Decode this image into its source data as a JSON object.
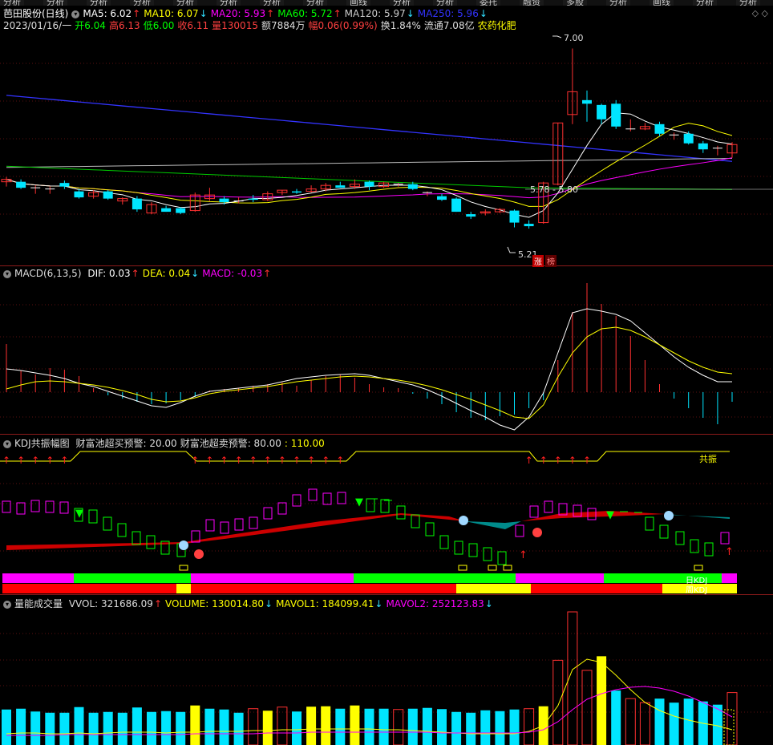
{
  "top_menu": [
    "分析",
    "分析",
    "分析",
    "分析",
    "分析",
    "分析",
    "分析",
    "分析",
    "画线",
    "分析",
    "分析",
    "委托",
    "融资",
    "多股",
    "分析",
    "画线",
    "分析",
    "分析"
  ],
  "window_controls": "◇ ◇",
  "price_panel": {
    "title": "芭田股份(日线)",
    "ma": [
      {
        "label": "MA5: 6.02",
        "arrow": "↑",
        "color": "#ffffff"
      },
      {
        "label": "MA10: 6.07",
        "arrow": "↓",
        "color": "#ffff00"
      },
      {
        "label": "MA20: 5.93",
        "arrow": "↑",
        "color": "#ff00ff"
      },
      {
        "label": "MA60: 5.72",
        "arrow": "↑",
        "color": "#00ff00"
      },
      {
        "label": "MA120: 5.97",
        "arrow": "↓",
        "color": "#cccccc"
      },
      {
        "label": "MA250: 5.96",
        "arrow": "↓",
        "color": "#3333ff"
      }
    ],
    "info": [
      {
        "text": "2023/01/16/一",
        "color": "#dddddd"
      },
      {
        "text": "开6.04",
        "color": "#00ff00"
      },
      {
        "text": "高6.13",
        "color": "#ff4040"
      },
      {
        "text": "低6.00",
        "color": "#00ff00"
      },
      {
        "text": "收6.11",
        "color": "#ff4040"
      },
      {
        "text": "量130015",
        "color": "#ff4040"
      },
      {
        "text": "额7884万",
        "color": "#dddddd"
      },
      {
        "text": "幅0.06(0.99%)",
        "color": "#ff4040"
      },
      {
        "text": "换1.84%",
        "color": "#dddddd"
      },
      {
        "text": "流通7.08亿",
        "color": "#dddddd"
      },
      {
        "text": "农药化肥",
        "color": "#ffff00"
      }
    ],
    "annotations": {
      "high": "7.00",
      "low": "5.21",
      "range": "5.78 - 5.80",
      "zt": "涨",
      "bang": "榜"
    }
  },
  "macd_panel": {
    "title": "MACD(6,13,5)",
    "items": [
      {
        "label": "DIF: 0.03",
        "arrow": "↑",
        "color": "#ffffff"
      },
      {
        "label": "DEA: 0.04",
        "arrow": "↓",
        "color": "#ffff00"
      },
      {
        "label": "MACD: -0.03",
        "arrow": "↑",
        "color": "#ff00ff"
      }
    ]
  },
  "kdj_panel": {
    "title": "KDJ共振幅图",
    "items": [
      {
        "label": "财富池超买预警: 20.00",
        "color": "#dddddd"
      },
      {
        "label": "财富池超卖预警: 80.00",
        "color": "#dddddd"
      },
      {
        "label": ": 110.00",
        "color": "#ffff00"
      }
    ],
    "resonance_label": "共振",
    "day_label": "日KDJ",
    "week_label": "周KDJ"
  },
  "vol_panel": {
    "title": "量能成交量",
    "items": [
      {
        "label": "VVOL: 321686.09",
        "arrow": "↑",
        "color": "#dddddd"
      },
      {
        "label": "VOLUME: 130014.80",
        "arrow": "↓",
        "color": "#ffff00"
      },
      {
        "label": "MAVOL1: 184099.41",
        "arrow": "↓",
        "color": "#ffff00"
      },
      {
        "label": "MAVOL2: 252123.83",
        "arrow": "↓",
        "color": "#ff00ff"
      }
    ]
  },
  "chart_data": {
    "type": "candlestick",
    "candles": [
      {
        "o": 5.8,
        "h": 5.84,
        "l": 5.76,
        "c": 5.82
      },
      {
        "o": 5.8,
        "h": 5.82,
        "l": 5.74,
        "c": 5.75
      },
      {
        "o": 5.75,
        "h": 5.77,
        "l": 5.7,
        "c": 5.75
      },
      {
        "o": 5.74,
        "h": 5.76,
        "l": 5.7,
        "c": 5.74
      },
      {
        "o": 5.79,
        "h": 5.81,
        "l": 5.74,
        "c": 5.76
      },
      {
        "o": 5.72,
        "h": 5.74,
        "l": 5.66,
        "c": 5.67
      },
      {
        "o": 5.68,
        "h": 5.73,
        "l": 5.66,
        "c": 5.71
      },
      {
        "o": 5.72,
        "h": 5.73,
        "l": 5.65,
        "c": 5.66
      },
      {
        "o": 5.64,
        "h": 5.67,
        "l": 5.61,
        "c": 5.66
      },
      {
        "o": 5.66,
        "h": 5.68,
        "l": 5.55,
        "c": 5.57
      },
      {
        "o": 5.54,
        "h": 5.63,
        "l": 5.53,
        "c": 5.61
      },
      {
        "o": 5.58,
        "h": 5.6,
        "l": 5.55,
        "c": 5.55
      },
      {
        "o": 5.58,
        "h": 5.59,
        "l": 5.53,
        "c": 5.54
      },
      {
        "o": 5.56,
        "h": 5.71,
        "l": 5.55,
        "c": 5.69
      },
      {
        "o": 5.66,
        "h": 5.75,
        "l": 5.64,
        "c": 5.69
      },
      {
        "o": 5.66,
        "h": 5.68,
        "l": 5.61,
        "c": 5.63
      },
      {
        "o": 5.64,
        "h": 5.67,
        "l": 5.62,
        "c": 5.64
      },
      {
        "o": 5.66,
        "h": 5.69,
        "l": 5.63,
        "c": 5.65
      },
      {
        "o": 5.65,
        "h": 5.72,
        "l": 5.64,
        "c": 5.7
      },
      {
        "o": 5.71,
        "h": 5.73,
        "l": 5.69,
        "c": 5.73
      },
      {
        "o": 5.72,
        "h": 5.74,
        "l": 5.7,
        "c": 5.71
      },
      {
        "o": 5.72,
        "h": 5.77,
        "l": 5.71,
        "c": 5.74
      },
      {
        "o": 5.74,
        "h": 5.79,
        "l": 5.72,
        "c": 5.77
      },
      {
        "o": 5.77,
        "h": 5.8,
        "l": 5.75,
        "c": 5.75
      },
      {
        "o": 5.76,
        "h": 5.82,
        "l": 5.74,
        "c": 5.78
      },
      {
        "o": 5.8,
        "h": 5.81,
        "l": 5.73,
        "c": 5.76
      },
      {
        "o": 5.76,
        "h": 5.8,
        "l": 5.75,
        "c": 5.79
      },
      {
        "o": 5.78,
        "h": 5.79,
        "l": 5.76,
        "c": 5.78
      },
      {
        "o": 5.78,
        "h": 5.8,
        "l": 5.73,
        "c": 5.74
      },
      {
        "o": 5.71,
        "h": 5.72,
        "l": 5.68,
        "c": 5.71
      },
      {
        "o": 5.68,
        "h": 5.7,
        "l": 5.64,
        "c": 5.65
      },
      {
        "o": 5.66,
        "h": 5.67,
        "l": 5.55,
        "c": 5.55
      },
      {
        "o": 5.53,
        "h": 5.55,
        "l": 5.49,
        "c": 5.51
      },
      {
        "o": 5.54,
        "h": 5.57,
        "l": 5.52,
        "c": 5.55
      },
      {
        "o": 5.55,
        "h": 5.58,
        "l": 5.54,
        "c": 5.57
      },
      {
        "o": 5.56,
        "h": 5.57,
        "l": 5.42,
        "c": 5.46
      },
      {
        "o": 5.45,
        "h": 5.48,
        "l": 5.41,
        "c": 5.43
      },
      {
        "o": 5.46,
        "h": 5.8,
        "l": 5.45,
        "c": 5.79
      },
      {
        "o": 5.78,
        "h": 6.29,
        "l": 5.77,
        "c": 6.29
      },
      {
        "o": 6.36,
        "h": 6.91,
        "l": 6.28,
        "c": 6.55
      },
      {
        "o": 6.48,
        "h": 6.56,
        "l": 6.3,
        "c": 6.45
      },
      {
        "o": 6.44,
        "h": 6.45,
        "l": 6.28,
        "c": 6.32
      },
      {
        "o": 6.45,
        "h": 6.48,
        "l": 6.24,
        "c": 6.26
      },
      {
        "o": 6.24,
        "h": 6.32,
        "l": 6.22,
        "c": 6.24
      },
      {
        "o": 6.24,
        "h": 6.29,
        "l": 6.23,
        "c": 6.26
      },
      {
        "o": 6.28,
        "h": 6.3,
        "l": 6.18,
        "c": 6.2
      },
      {
        "o": 6.19,
        "h": 6.21,
        "l": 6.15,
        "c": 6.19
      },
      {
        "o": 6.2,
        "h": 6.22,
        "l": 6.11,
        "c": 6.12
      },
      {
        "o": 6.12,
        "h": 6.14,
        "l": 6.04,
        "c": 6.07
      },
      {
        "o": 6.08,
        "h": 6.1,
        "l": 6.02,
        "c": 6.08
      },
      {
        "o": 6.04,
        "h": 6.13,
        "l": 6.0,
        "c": 6.11
      }
    ],
    "ma250": 5.96,
    "volume": [
      {
        "v": 88000.0,
        "c": "cyan"
      },
      {
        "v": 90000.0,
        "c": "cyan"
      },
      {
        "v": 83000.0,
        "c": "cyan"
      },
      {
        "v": 80000.0,
        "c": "cyan"
      },
      {
        "v": 80000.0,
        "c": "cyan"
      },
      {
        "v": 94000.0,
        "c": "cyan"
      },
      {
        "v": 80000.0,
        "c": "cyan"
      },
      {
        "v": 82000.0,
        "c": "cyan"
      },
      {
        "v": 80000.0,
        "c": "cyan"
      },
      {
        "v": 93000.0,
        "c": "cyan"
      },
      {
        "v": 82000.0,
        "c": "cyan"
      },
      {
        "v": 84000.0,
        "c": "cyan"
      },
      {
        "v": 82000.0,
        "c": "cyan"
      },
      {
        "v": 98000.0,
        "c": "yellow"
      },
      {
        "v": 90000.0,
        "c": "cyan"
      },
      {
        "v": 88000.0,
        "c": "cyan"
      },
      {
        "v": 80000.0,
        "c": "cyan"
      },
      {
        "v": 90000.0,
        "c": "red"
      },
      {
        "v": 85000.0,
        "c": "yellow"
      },
      {
        "v": 94000.0,
        "c": "red"
      },
      {
        "v": 83000.0,
        "c": "cyan"
      },
      {
        "v": 95000.0,
        "c": "yellow"
      },
      {
        "v": 96000.0,
        "c": "yellow"
      },
      {
        "v": 90000.0,
        "c": "cyan"
      },
      {
        "v": 98000.0,
        "c": "yellow"
      },
      {
        "v": 90000.0,
        "c": "cyan"
      },
      {
        "v": 90000.0,
        "c": "cyan"
      },
      {
        "v": 88000.0,
        "c": "red"
      },
      {
        "v": 90000.0,
        "c": "cyan"
      },
      {
        "v": 92000.0,
        "c": "cyan"
      },
      {
        "v": 89000.0,
        "c": "cyan"
      },
      {
        "v": 82000.0,
        "c": "cyan"
      },
      {
        "v": 80000.0,
        "c": "cyan"
      },
      {
        "v": 86000.0,
        "c": "cyan"
      },
      {
        "v": 84000.0,
        "c": "cyan"
      },
      {
        "v": 88000.0,
        "c": "cyan"
      },
      {
        "v": 90000.0,
        "c": "red"
      },
      {
        "v": 96000.0,
        "c": "yellow"
      },
      {
        "v": 210000.0,
        "c": "red"
      },
      {
        "v": 330000.0,
        "c": "red"
      },
      {
        "v": 185000.0,
        "c": "red"
      },
      {
        "v": 220000.0,
        "c": "yellow"
      },
      {
        "v": 135000.0,
        "c": "cyan"
      },
      {
        "v": 115000.0,
        "c": "red"
      },
      {
        "v": 105000.0,
        "c": "red"
      },
      {
        "v": 115000.0,
        "c": "cyan"
      },
      {
        "v": 105000.0,
        "c": "cyan"
      },
      {
        "v": 115000.0,
        "c": "cyan"
      },
      {
        "v": 108000.0,
        "c": "cyan"
      },
      {
        "v": 100000.0,
        "c": "cyan"
      },
      {
        "v": 130000.0,
        "c": "red"
      }
    ]
  }
}
